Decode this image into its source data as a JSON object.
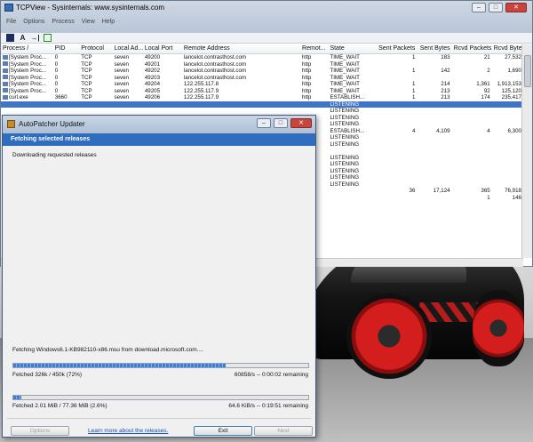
{
  "tcpview": {
    "title": "TCPView - Sysinternals: www.sysinternals.com",
    "menu": [
      "File",
      "Options",
      "Process",
      "View",
      "Help"
    ],
    "toolbar": {
      "save": "save-icon",
      "a": "A",
      "connect": "→|",
      "refresh": "refresh-icon"
    },
    "columns": [
      "Process  /",
      "PID",
      "Protocol",
      "Local Ad...",
      "Local Port",
      "Remote Address",
      "Remot...",
      "State",
      "Sent Packets",
      "Sent Bytes",
      "Rcvd Packets",
      "Rcvd Bytes"
    ],
    "rows": [
      [
        "[System Proc...",
        "0",
        "TCP",
        "seven",
        "49200",
        "lancelot.contrasthost.com",
        "http",
        "TIME_WAIT",
        "1",
        "183",
        "21",
        "27,532"
      ],
      [
        "[System Proc...",
        "0",
        "TCP",
        "seven",
        "49201",
        "lancelot.contrasthost.com",
        "http",
        "TIME_WAIT",
        "",
        "",
        "",
        ""
      ],
      [
        "[System Proc...",
        "0",
        "TCP",
        "seven",
        "49202",
        "lancelot.contrasthost.com",
        "http",
        "TIME_WAIT",
        "1",
        "142",
        "2",
        "1,690"
      ],
      [
        "[System Proc...",
        "0",
        "TCP",
        "seven",
        "49203",
        "lancelot.contrasthost.com",
        "http",
        "TIME_WAIT",
        "",
        "",
        "",
        ""
      ],
      [
        "[System Proc...",
        "0",
        "TCP",
        "seven",
        "49204",
        "122.255.117.8",
        "http",
        "TIME_WAIT",
        "1",
        "214",
        "1,361",
        "1,913,153"
      ],
      [
        "[System Proc...",
        "0",
        "TCP",
        "seven",
        "49205",
        "122.255.117.9",
        "http",
        "TIME_WAIT",
        "1",
        "213",
        "92",
        "125,120"
      ],
      [
        "curl.exe",
        "3660",
        "TCP",
        "seven",
        "49206",
        "122.255.117.9",
        "http",
        "ESTABLISH...",
        "1",
        "213",
        "174",
        "235,417"
      ],
      [
        "",
        "",
        "",
        "",
        "",
        "",
        "",
        "LISTENING",
        "",
        "",
        "",
        ""
      ],
      [
        "",
        "",
        "",
        "",
        "",
        "",
        "",
        "LISTENING",
        "",
        "",
        "",
        ""
      ],
      [
        "",
        "",
        "",
        "",
        "",
        "",
        "",
        "LISTENING",
        "",
        "",
        "",
        ""
      ],
      [
        "",
        "",
        "",
        "",
        "",
        "",
        "",
        "LISTENING",
        "",
        "",
        "",
        ""
      ],
      [
        "",
        "",
        "",
        "",
        "",
        "",
        "",
        "ESTABLISH...",
        "4",
        "4,109",
        "4",
        "6,300"
      ],
      [
        "",
        "",
        "",
        "",
        "",
        "",
        "",
        "LISTENING",
        "",
        "",
        "",
        ""
      ],
      [
        "",
        "",
        "",
        "",
        "",
        "",
        "",
        "LISTENING",
        "",
        "",
        "",
        ""
      ],
      [
        "",
        "",
        "",
        "",
        "",
        "",
        "",
        "",
        "",
        "",
        "",
        ""
      ],
      [
        "",
        "",
        "",
        "",
        "",
        "",
        "",
        "LISTENING",
        "",
        "",
        "",
        ""
      ],
      [
        "",
        "",
        "",
        "",
        "",
        "",
        "",
        "LISTENING",
        "",
        "",
        "",
        ""
      ],
      [
        "",
        "",
        "",
        "",
        "",
        "",
        "",
        "LISTENING",
        "",
        "",
        "",
        ""
      ],
      [
        "",
        "",
        "",
        "",
        "",
        "",
        "",
        "LISTENING",
        "",
        "",
        "",
        ""
      ],
      [
        "",
        "",
        "",
        "",
        "",
        "",
        "",
        "LISTENING",
        "",
        "",
        "",
        ""
      ],
      [
        "",
        "",
        "",
        "",
        "",
        "",
        "",
        "",
        "36",
        "17,124",
        "365",
        "76,918"
      ],
      [
        "",
        "",
        "",
        "",
        "",
        "",
        "",
        "",
        "",
        "",
        "1",
        "146"
      ]
    ],
    "selected_row_index": 7
  },
  "autopatcher": {
    "title": "AutoPatcher Updater",
    "banner": "Fetching selected releases",
    "subtitle": "Downloading requested releases",
    "fetching_line": "Fetching Windows6.1-KB982110-x86.msu from download.microsoft.com....",
    "progress1": {
      "fraction": 0.72,
      "left": "Fetched 326k / 450k (72%)",
      "right": "60858/s -- 0:00:02 remaining"
    },
    "progress2": {
      "fraction": 0.026,
      "left": "Fetched 2.01 MiB / 77.36 MiB (2.6%)",
      "right": "64.6 KiB/s -- 0:19:51 remaining"
    },
    "buttons": {
      "options": "Options",
      "link": "Learn more about the releases.",
      "exit": "Exit",
      "next": "Next"
    }
  }
}
